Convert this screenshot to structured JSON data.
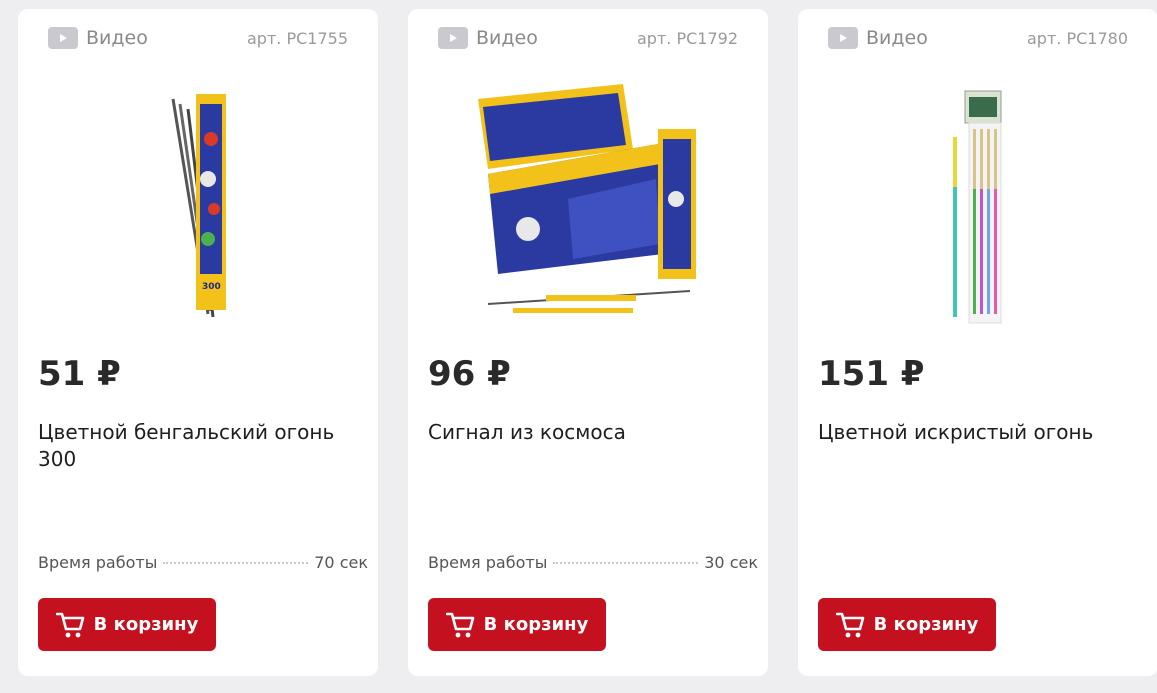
{
  "products": [
    {
      "video_label": "Видео",
      "sku": "арт. PC1755",
      "price": "51 ₽",
      "title": "Цветной бенгальский огонь 300",
      "spec_label": "Время работы",
      "spec_value": "70 сек",
      "cart_label": "В корзину"
    },
    {
      "video_label": "Видео",
      "sku": "арт. PC1792",
      "price": "96 ₽",
      "title": "Сигнал из космоса",
      "spec_label": "Время работы",
      "spec_value": "30 сек",
      "cart_label": "В корзину"
    },
    {
      "video_label": "Видео",
      "sku": "арт. PC1780",
      "price": "151 ₽",
      "title": "Цветной искристый огонь",
      "cart_label": "В корзину"
    }
  ],
  "colors": {
    "accent": "#c5111f",
    "background": "#eeeef1",
    "card": "#ffffff"
  },
  "icons": [
    "play-icon",
    "cart-icon"
  ]
}
